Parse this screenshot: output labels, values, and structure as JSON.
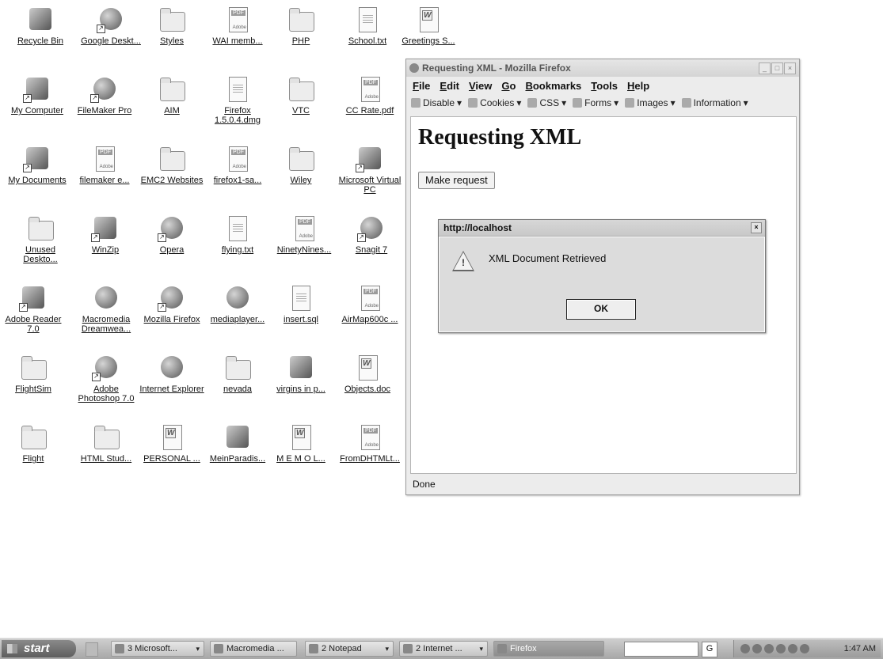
{
  "desktop": {
    "icons": [
      {
        "label": "Recycle Bin"
      },
      {
        "label": "Google Deskt..."
      },
      {
        "label": "Styles"
      },
      {
        "label": "WAI memb..."
      },
      {
        "label": "PHP"
      },
      {
        "label": "School.txt"
      },
      {
        "label": "Greetings S..."
      },
      {
        "label": "My Computer"
      },
      {
        "label": "FileMaker Pro"
      },
      {
        "label": "AIM"
      },
      {
        "label": "Firefox 1.5.0.4.dmg"
      },
      {
        "label": "VTC"
      },
      {
        "label": "CC Rate.pdf"
      },
      {
        "label": "My Documents"
      },
      {
        "label": "filemaker e..."
      },
      {
        "label": "EMC2 Websites"
      },
      {
        "label": "firefox1-sa..."
      },
      {
        "label": "Wiley"
      },
      {
        "label": "Microsoft Virtual PC"
      },
      {
        "label": "Unused Deskto..."
      },
      {
        "label": "WinZip"
      },
      {
        "label": "Opera"
      },
      {
        "label": "flying.txt"
      },
      {
        "label": "NinetyNines..."
      },
      {
        "label": "Snagit 7"
      },
      {
        "label": "Adobe Reader 7.0"
      },
      {
        "label": "Macromedia Dreamwea..."
      },
      {
        "label": "Mozilla Firefox"
      },
      {
        "label": "mediaplayer..."
      },
      {
        "label": "insert.sql"
      },
      {
        "label": "AirMap600c ..."
      },
      {
        "label": "FlightSim"
      },
      {
        "label": "Adobe Photoshop 7.0"
      },
      {
        "label": "Internet Explorer"
      },
      {
        "label": "nevada"
      },
      {
        "label": "virgins in p..."
      },
      {
        "label": "Objects.doc"
      },
      {
        "label": "Flight"
      },
      {
        "label": "HTML Stud..."
      },
      {
        "label": "PERSONAL ..."
      },
      {
        "label": "MeinParadis..."
      },
      {
        "label": "M E M O L..."
      },
      {
        "label": "FromDHTMLt..."
      }
    ],
    "pdf_tag": "PDF",
    "pdf_brand": "Adobe",
    "word_tag": "W"
  },
  "firefox": {
    "title": "Requesting XML - Mozilla Firefox",
    "menus": [
      "File",
      "Edit",
      "View",
      "Go",
      "Bookmarks",
      "Tools",
      "Help"
    ],
    "toolbar": [
      "Disable",
      "Cookies",
      "CSS",
      "Forms",
      "Images",
      "Information"
    ],
    "page_heading": "Requesting XML",
    "request_button": "Make request",
    "status": "Done"
  },
  "dialog": {
    "title": "http://localhost",
    "message": "XML Document Retrieved",
    "ok": "OK",
    "warn_symbol": "!"
  },
  "taskbar": {
    "start": "start",
    "buttons": [
      {
        "label": "3 Microsoft..."
      },
      {
        "label": "Macromedia ..."
      },
      {
        "label": "2 Notepad"
      },
      {
        "label": "2 Internet ..."
      },
      {
        "label": "Firefox"
      }
    ],
    "search_g": "G",
    "clock": "1:47 AM"
  }
}
